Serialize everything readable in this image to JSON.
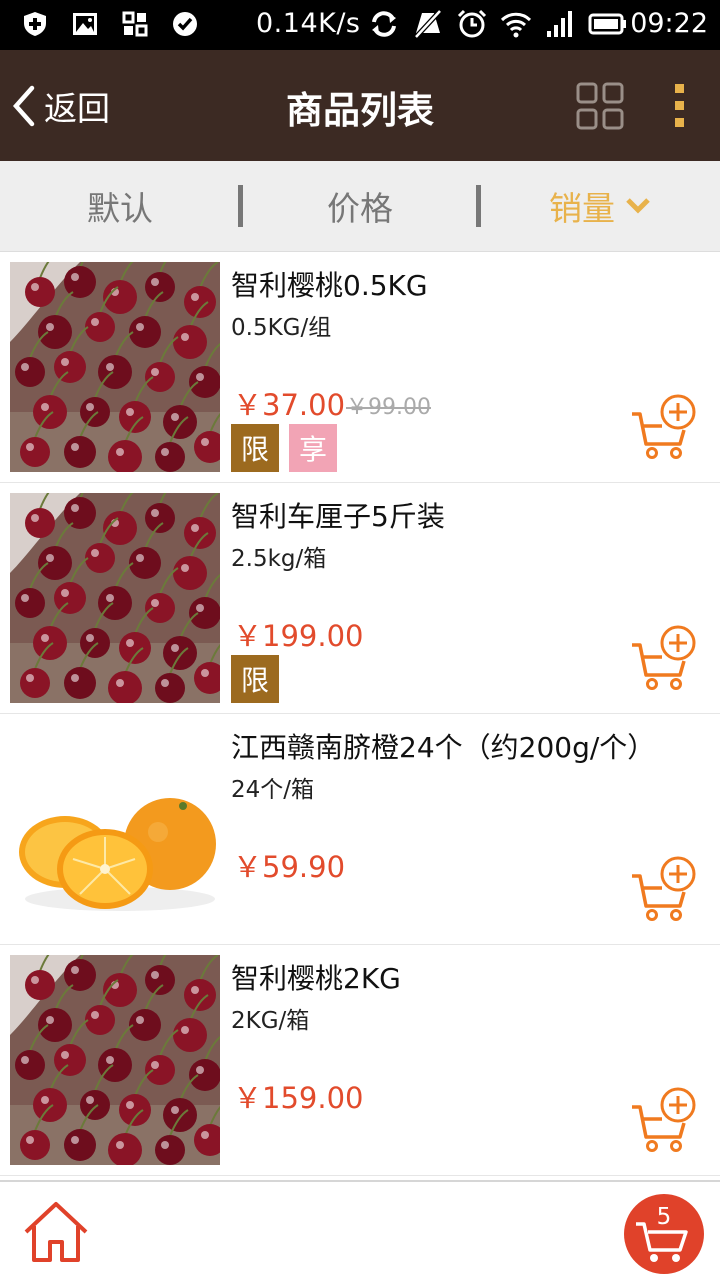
{
  "status_bar": {
    "net_speed": "0.14K/s",
    "time": "09:22"
  },
  "nav": {
    "back_label": "返回",
    "title": "商品列表"
  },
  "sort": {
    "tabs": [
      {
        "label": "默认"
      },
      {
        "label": "价格"
      },
      {
        "label": "销量",
        "active": true
      }
    ]
  },
  "products": [
    {
      "name": "智利樱桃0.5KG",
      "spec": "0.5KG/组",
      "price": "￥37.00",
      "original_price": "￥99.00",
      "tags": [
        "限",
        "享"
      ],
      "image": "cherries"
    },
    {
      "name": "智利车厘子5斤装",
      "spec": "2.5kg/箱",
      "price": "￥199.00",
      "original_price": "",
      "tags": [
        "限"
      ],
      "image": "cherries"
    },
    {
      "name": "江西赣南脐橙24个（约200g/个）",
      "spec": "24个/箱",
      "price": "￥59.90",
      "original_price": "",
      "tags": [],
      "image": "oranges"
    },
    {
      "name": "智利樱桃2KG",
      "spec": "2KG/箱",
      "price": "￥159.00",
      "original_price": "",
      "tags": [],
      "image": "cherries"
    }
  ],
  "bottom": {
    "cart_count": "5"
  },
  "colors": {
    "nav_bg": "#3c2a23",
    "accent_gold": "#e8b24b",
    "price_red": "#e24b2c",
    "cart_orange": "#f07a1f",
    "tag_limit": "#9c6a1f",
    "tag_share": "#f2a4b5"
  },
  "icons": [
    "shield-icon",
    "image-icon",
    "apps-icon",
    "check-icon",
    "sync-icon",
    "mute-icon",
    "alarm-icon",
    "wifi-icon",
    "signal-icon",
    "battery-icon",
    "back-chevron-icon",
    "grid-icon",
    "more-icon",
    "chevron-down-icon",
    "add-to-cart-icon",
    "home-icon",
    "cart-icon"
  ]
}
